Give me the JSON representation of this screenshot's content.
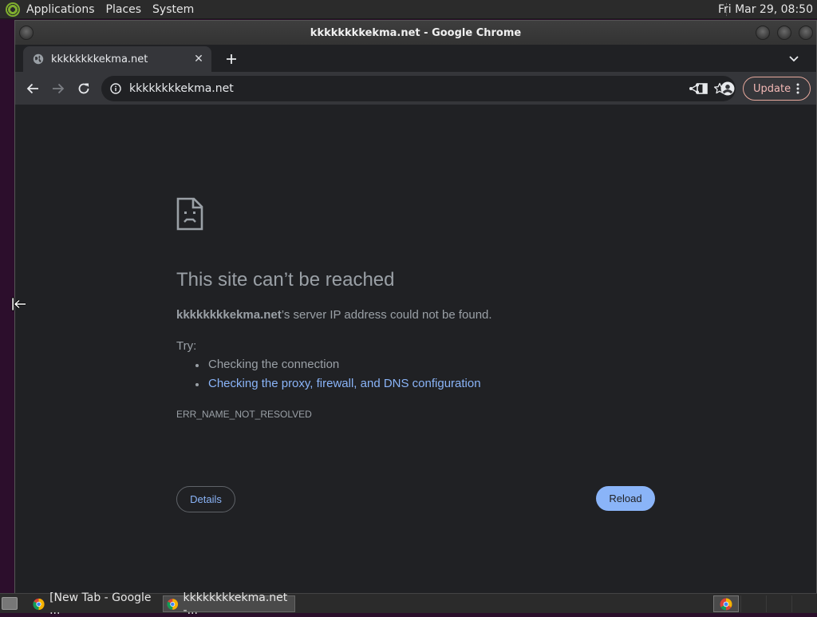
{
  "top_panel": {
    "menus": [
      "Applications",
      "Places",
      "System"
    ],
    "clock": "Fri Mar 29, 08:50"
  },
  "window": {
    "title": "kkkkkkkkekma.net - Google Chrome"
  },
  "tabs": [
    {
      "title": "kkkkkkkkekma.net",
      "active": true,
      "favicon": "globe-icon"
    }
  ],
  "toolbar": {
    "url": "kkkkkkkkekma.net",
    "update_label": "Update"
  },
  "error_page": {
    "heading": "This site can’t be reached",
    "host": "kkkkkkkkekma.net",
    "summary_suffix": "’s server IP address could not be found.",
    "try_label": "Try:",
    "suggestions": [
      "Checking the connection",
      "Checking the proxy, firewall, and DNS configuration"
    ],
    "error_code": "ERR_NAME_NOT_RESOLVED",
    "details_label": "Details",
    "reload_label": "Reload"
  },
  "taskbar": {
    "items": [
      {
        "label": "[New Tab - Google ...",
        "icon": "chrome-icon",
        "active": false
      },
      {
        "label": "kkkkkkkkekma.net -...",
        "icon": "chrome-icon",
        "active": true
      }
    ]
  },
  "colors": {
    "page_background": "#202124",
    "toolbar": "#35363a",
    "link": "#8ab4f8",
    "muted_text": "#9aa0a6"
  }
}
